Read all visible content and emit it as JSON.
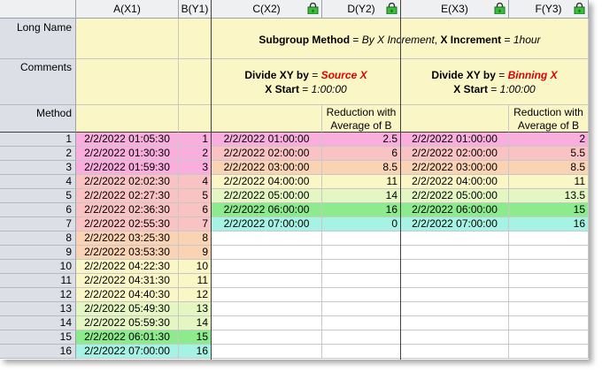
{
  "columns": [
    {
      "label": "A(X1)",
      "locked": false
    },
    {
      "label": "B(Y1)",
      "locked": false
    },
    {
      "label": "C(X2)",
      "locked": true
    },
    {
      "label": "D(Y2)",
      "locked": true
    },
    {
      "label": "E(X3)",
      "locked": true
    },
    {
      "label": "F(Y3)",
      "locked": true
    }
  ],
  "row_labels": {
    "long_name": "Long Name",
    "comments": "Comments",
    "method": "Method"
  },
  "long_name": {
    "prefix": "Subgroup Method",
    "eq1": " = ",
    "method_value": "By X Increment",
    "sep": ", ",
    "increment_label": "X Increment",
    "eq2": " = ",
    "increment_value": "1hour"
  },
  "comments_c": {
    "label": "Divide XY by",
    "eq": " = ",
    "value": "Source X",
    "start_label": "X Start",
    "start_eq": " = ",
    "start_value": "1:00:00"
  },
  "comments_e": {
    "label": "Divide XY by",
    "eq": " = ",
    "value": "Binning X",
    "start_label": "X Start",
    "start_eq": " = ",
    "start_value": "1:00:00"
  },
  "method_d": "Reduction with Average of B",
  "method_f": "Reduction with Average of B",
  "colors": {
    "pink": "#f9aedd",
    "salmon": "#f9c3c3",
    "peach": "#f9d3b4",
    "yellow": "#fbf6c6",
    "lightgreen": "#e4f6c2",
    "green": "#8ceb8c",
    "cyan": "#a7f3e3",
    "white": "#ffffff"
  },
  "rows": [
    {
      "n": "1",
      "a": "2/2/2022 01:05:30",
      "b": "1",
      "c": "2/2/2022 01:00:00",
      "d": "2.5",
      "e": "2/2/2022 01:00:00",
      "f": "2",
      "ca": "pink",
      "cc": "pink"
    },
    {
      "n": "2",
      "a": "2/2/2022 01:30:30",
      "b": "2",
      "c": "2/2/2022 02:00:00",
      "d": "6",
      "e": "2/2/2022 02:00:00",
      "f": "5.5",
      "ca": "pink",
      "cc": "salmon"
    },
    {
      "n": "3",
      "a": "2/2/2022 01:59:30",
      "b": "3",
      "c": "2/2/2022 03:00:00",
      "d": "8.5",
      "e": "2/2/2022 03:00:00",
      "f": "8.5",
      "ca": "pink",
      "cc": "peach"
    },
    {
      "n": "4",
      "a": "2/2/2022 02:02:30",
      "b": "4",
      "c": "2/2/2022 04:00:00",
      "d": "11",
      "e": "2/2/2022 04:00:00",
      "f": "11",
      "ca": "salmon",
      "cc": "yellow"
    },
    {
      "n": "5",
      "a": "2/2/2022 02:27:30",
      "b": "5",
      "c": "2/2/2022 05:00:00",
      "d": "14",
      "e": "2/2/2022 05:00:00",
      "f": "13.5",
      "ca": "salmon",
      "cc": "lightgreen"
    },
    {
      "n": "6",
      "a": "2/2/2022 02:36:30",
      "b": "6",
      "c": "2/2/2022 06:00:00",
      "d": "16",
      "e": "2/2/2022 06:00:00",
      "f": "15",
      "ca": "salmon",
      "cc": "green"
    },
    {
      "n": "7",
      "a": "2/2/2022 02:55:30",
      "b": "7",
      "c": "2/2/2022 07:00:00",
      "d": "0",
      "e": "2/2/2022 07:00:00",
      "f": "16",
      "ca": "salmon",
      "cc": "cyan"
    },
    {
      "n": "8",
      "a": "2/2/2022 03:25:30",
      "b": "8",
      "c": "",
      "d": "",
      "e": "",
      "f": "",
      "ca": "peach",
      "cc": "white"
    },
    {
      "n": "9",
      "a": "2/2/2022 03:53:30",
      "b": "9",
      "c": "",
      "d": "",
      "e": "",
      "f": "",
      "ca": "peach",
      "cc": "white"
    },
    {
      "n": "10",
      "a": "2/2/2022 04:22:30",
      "b": "10",
      "c": "",
      "d": "",
      "e": "",
      "f": "",
      "ca": "yellow",
      "cc": "white"
    },
    {
      "n": "11",
      "a": "2/2/2022 04:31:30",
      "b": "11",
      "c": "",
      "d": "",
      "e": "",
      "f": "",
      "ca": "yellow",
      "cc": "white"
    },
    {
      "n": "12",
      "a": "2/2/2022 04:40:30",
      "b": "12",
      "c": "",
      "d": "",
      "e": "",
      "f": "",
      "ca": "yellow",
      "cc": "white"
    },
    {
      "n": "13",
      "a": "2/2/2022 05:49:30",
      "b": "13",
      "c": "",
      "d": "",
      "e": "",
      "f": "",
      "ca": "lightgreen",
      "cc": "white"
    },
    {
      "n": "14",
      "a": "2/2/2022 05:59:30",
      "b": "14",
      "c": "",
      "d": "",
      "e": "",
      "f": "",
      "ca": "lightgreen",
      "cc": "white"
    },
    {
      "n": "15",
      "a": "2/2/2022 06:01:30",
      "b": "15",
      "c": "",
      "d": "",
      "e": "",
      "f": "",
      "ca": "green",
      "cc": "white"
    },
    {
      "n": "16",
      "a": "2/2/2022 07:00:00",
      "b": "16",
      "c": "",
      "d": "",
      "e": "",
      "f": "",
      "ca": "cyan",
      "cc": "white"
    }
  ]
}
